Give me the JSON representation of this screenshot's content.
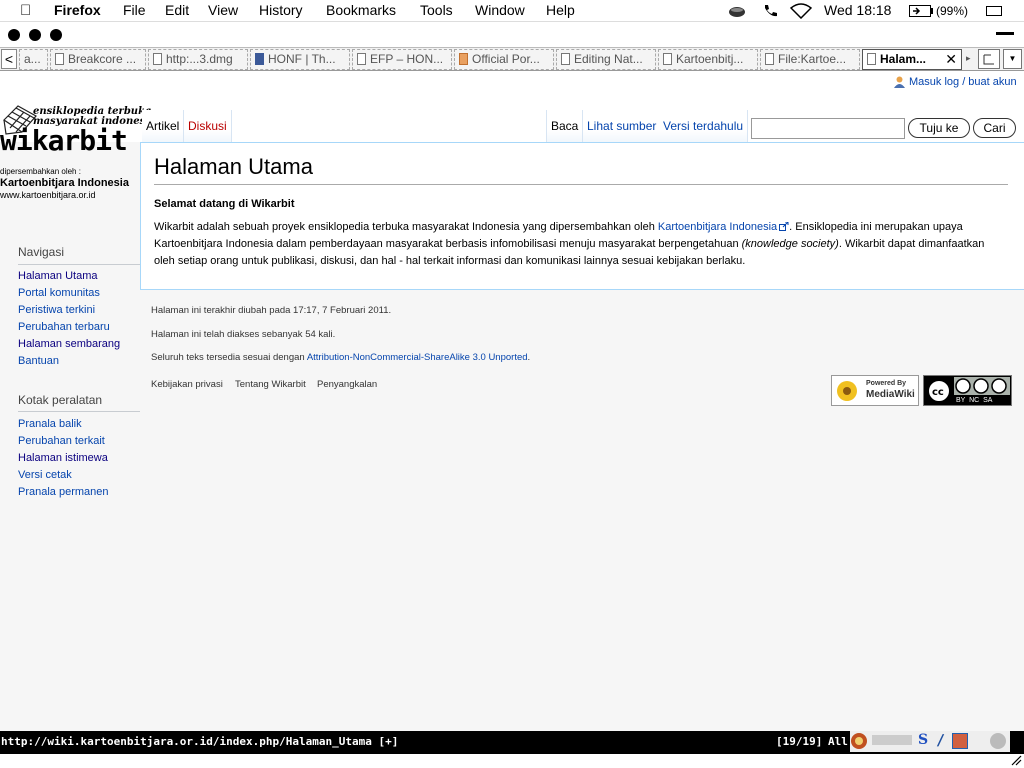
{
  "menubar": {
    "apple": "",
    "app": "Firefox",
    "items": [
      "File",
      "Edit",
      "View",
      "History",
      "Bookmarks",
      "Tools",
      "Window",
      "Help"
    ],
    "clock": "Wed 18:18",
    "battery": "(99%)"
  },
  "tabs": [
    {
      "label": "a..."
    },
    {
      "label": "Breakcore ..."
    },
    {
      "label": "http:...3.dmg"
    },
    {
      "label": "HONF | Th..."
    },
    {
      "label": "EFP – HON..."
    },
    {
      "label": "Official Por..."
    },
    {
      "label": "Editing Nat..."
    },
    {
      "label": "Kartoenbitj..."
    },
    {
      "label": "File:Kartoe..."
    },
    {
      "label": "Halam..."
    }
  ],
  "tab_close": "✕",
  "logo": {
    "tagline1": "ensiklopedia terbuka",
    "tagline2": "masyarakat indonesia",
    "name": "wikarbit",
    "presented_by": "dipersembahkan oleh :",
    "org": "Kartoenbitjara Indonesia",
    "url": "www.kartoenbitjara.or.id"
  },
  "personal": {
    "login": "Masuk log / buat akun"
  },
  "views": {
    "article": "Artikel",
    "discuss": "Diskusi",
    "read": "Baca",
    "source": "Lihat sumber",
    "history": "Versi terdahulu"
  },
  "search": {
    "value": "",
    "go": "Tuju ke",
    "find": "Cari"
  },
  "article": {
    "title": "Halaman Utama",
    "welcome": "Selamat datang di Wikarbit",
    "p1": "Wikarbit adalah sebuah proyek ensiklopedia terbuka masyarakat Indonesia yang dipersembahkan oleh ",
    "p1_link": "Kartoenbitjara Indonesia",
    "p1_b": ". Ensiklopedia ini merupakan upaya",
    "p2": "Kartoenbitjara Indonesia dalam pemberdayaan masyarakat berbasis infomobilisasi menuju masyarakat berpengetahuan ",
    "p2_em": "(knowledge society)",
    "p2_b": ". Wikarbit dapat dimanfaatkan",
    "p3": "oleh setiap orang untuk publikasi, diskusi, dan hal - hal terkait informasi dan komunikasi lainnya sesuai kebijakan berlaku."
  },
  "sidebar": {
    "nav_heading": "Navigasi",
    "nav": [
      "Halaman Utama",
      "Portal komunitas",
      "Peristiwa terkini",
      "Perubahan terbaru",
      "Halaman sembarang",
      "Bantuan"
    ],
    "tools_heading": "Kotak peralatan",
    "tools": [
      "Pranala balik",
      "Perubahan terkait",
      "Halaman istimewa",
      "Versi cetak",
      "Pranala permanen"
    ]
  },
  "footer": {
    "lastmod": "Halaman ini terakhir diubah pada 17:17, 7 Februari 2011.",
    "views": "Halaman ini telah diakses sebanyak 54 kali.",
    "license_pre": "Seluruh teks tersedia sesuai dengan ",
    "license_link": "Attribution-NonCommercial-ShareAlike 3.0 Unported",
    "license_post": ".",
    "privacy": "Kebijakan privasi",
    "about": "Tentang Wikarbit",
    "disclaimer": "Penyangkalan",
    "mw_badge_1": "Powered By",
    "mw_badge_2": "MediaWiki",
    "cc_badge": "BY  NC  SA"
  },
  "statusbar": {
    "url": "http://wiki.kartoenbitjara.or.id/index.php/Halaman_Utama [+]",
    "count": "[19/19]",
    "all": "All"
  }
}
